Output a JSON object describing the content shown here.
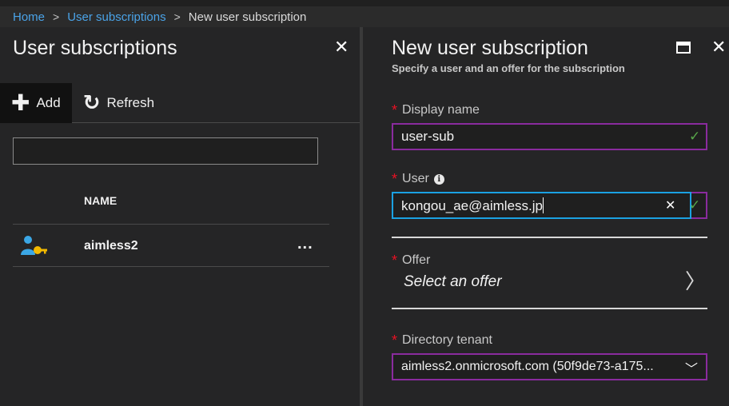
{
  "breadcrumb": {
    "items": [
      "Home",
      "User subscriptions"
    ],
    "separator": ">",
    "current": "New user subscription"
  },
  "left_blade": {
    "title": "User subscriptions",
    "close": "✕",
    "toolbar": {
      "add_label": "Add",
      "refresh_label": "Refresh"
    },
    "filter_placeholder": "",
    "columns": [
      "NAME"
    ],
    "rows": [
      {
        "name": "aimless2",
        "more": "..."
      }
    ]
  },
  "right_blade": {
    "title": "New user subscription",
    "subtitle": "Specify a user and an offer for the subscription",
    "close": "✕",
    "required_mark": "*",
    "fields": {
      "display_name": {
        "label": "Display name",
        "value": "user-sub"
      },
      "user": {
        "label": "User",
        "value": "kongou_ae@aimless.jp",
        "clear": "✕"
      },
      "offer": {
        "label": "Offer",
        "value": "Select an offer"
      },
      "directory_tenant": {
        "label": "Directory tenant",
        "value": "aimless2.onmicrosoft.com (50f9de73-a175..."
      }
    }
  },
  "colors": {
    "accent_link": "#4aa3e8",
    "valid_border": "#8a2b9e",
    "focus_border": "#1ba1e2",
    "required": "#e81123",
    "check": "#57a64a"
  }
}
